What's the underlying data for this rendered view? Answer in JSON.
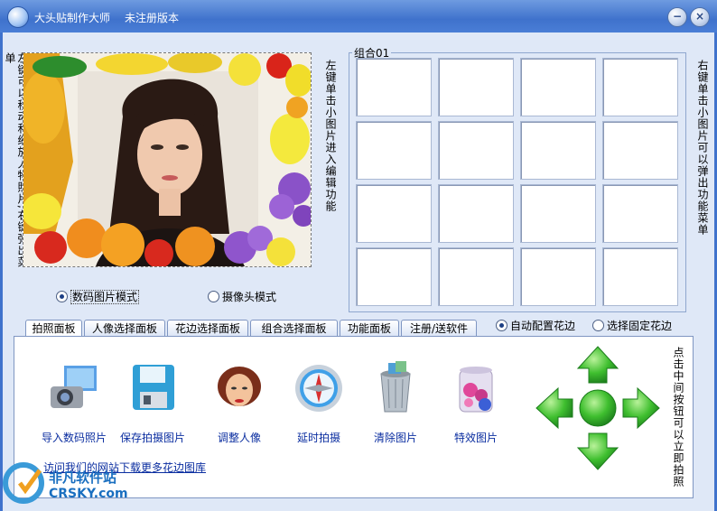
{
  "window": {
    "title": "大头贴制作大师",
    "status": "未注册版本",
    "minimize_label": "−",
    "close_label": "×"
  },
  "left_hint": "左键可以移动和缩放人物照片,右键弹出菜单",
  "middle_hint": "左键单击小图片进入编辑功能",
  "right_hint": "右键单击小图片可以弹出功能菜单",
  "group": {
    "label": "组合01",
    "cells": 16
  },
  "mode": {
    "digital_label": "数码图片模式",
    "camera_label": "摄像头模式",
    "selected": "digital"
  },
  "border_mode": {
    "auto_label": "自动配置花边",
    "fixed_label": "选择固定花边",
    "selected": "auto"
  },
  "tabs": [
    "拍照面板",
    "人像选择面板",
    "花边选择面板",
    "组合选择面板",
    "功能面板",
    "注册/送软件"
  ],
  "tools": [
    {
      "label": "导入数码照片",
      "icon": "camera-photo-icon"
    },
    {
      "label": "保存拍摄图片",
      "icon": "floppy-disk-icon"
    },
    {
      "label": "调整人像",
      "icon": "portrait-face-icon"
    },
    {
      "label": "延时拍摄",
      "icon": "compass-timer-icon"
    },
    {
      "label": "清除图片",
      "icon": "trash-bin-icon"
    },
    {
      "label": "特效图片",
      "icon": "flower-jar-icon"
    }
  ],
  "website_link": "访问我们的网站下载更多花边图库",
  "dpad_hint": "点击中间按钮可以立即拍照",
  "watermark": {
    "name": "非凡软件站",
    "domain": "CRSKY.com"
  },
  "colors": {
    "title_bar": "#3f72cc",
    "link": "#0b2ea0",
    "arrow": "#2fae2f"
  }
}
